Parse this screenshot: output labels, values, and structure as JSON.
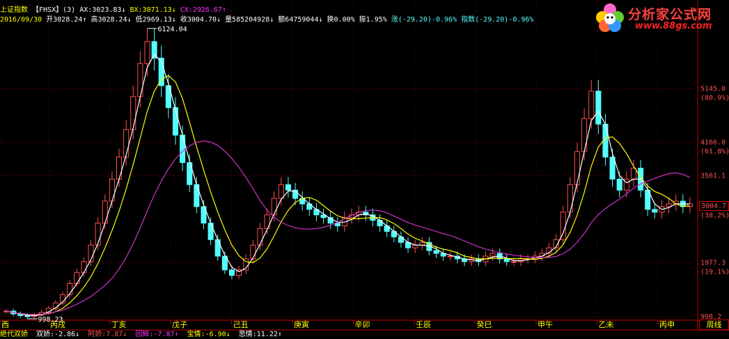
{
  "header": {
    "index_name": "上证指数",
    "indicator": "【FHSX】(3)",
    "ax": "AX:3023.83↓",
    "bx": "BX:3071.13↓",
    "cx": "CX:2926.67↑",
    "date": "2016/09/30",
    "open": "开3028.24↑",
    "high": "高3028.24↓",
    "low": "低2969.13↓",
    "close": "收3004.70↓",
    "volume": "量585204928↓",
    "amount": "额64759044↓",
    "turnover": "换0.00%",
    "amplitude": "振1.95%",
    "change": "涨(-29.20)-0.96%",
    "index_change": "指数(-29.20)-0.96%"
  },
  "logo": {
    "title": "分析家公式网",
    "url": "www.88gs.com"
  },
  "price_axis": {
    "labels": [
      {
        "price": 5145.0,
        "text": "5145.0",
        "pct": "(80.9%)"
      },
      {
        "price": 4166.0,
        "text": "4166.0",
        "pct": "(61.8%)"
      },
      {
        "price": 3561.1,
        "text": "3561.1",
        "pct": ""
      },
      {
        "price": 3004.7,
        "text": "3004.7",
        "pct": "(38.2%)"
      },
      {
        "price": 1977.3,
        "text": "1977.3",
        "pct": "(19.1%)"
      },
      {
        "price": 998.2,
        "text": "998.2",
        "pct": ""
      }
    ],
    "current": "3004.7",
    "high_marker": "6124.04",
    "low_marker": "998.23"
  },
  "time_axis": [
    "西",
    "丙戌",
    "丁亥",
    "戊子",
    "己丑",
    "庚寅",
    "辛卯",
    "壬辰",
    "癸巳",
    "甲午",
    "乙未",
    "丙申"
  ],
  "cycle_button": "周线",
  "bottom": {
    "name": "绝代双娇",
    "items": [
      {
        "text": "双娇:-2.86↓",
        "color": "#ffffff"
      },
      {
        "text": "阿娇:7.87↓",
        "color": "#ff5050"
      },
      {
        "text": "回辉:-7.87↑",
        "color": "#ff33ff"
      },
      {
        "text": "宝情:-6.90↓",
        "color": "#ffff00"
      },
      {
        "text": "悲情:11.22↑",
        "color": "#ffffff"
      }
    ]
  },
  "colors": {
    "ma_fast": "#ffffff",
    "ma_mid": "#ffff00",
    "ma_slow": "#cc33cc",
    "up": "#ff5050",
    "down": "#54ffff",
    "grid": "#8b0000"
  },
  "chart_data": {
    "type": "candlestick",
    "ylim": [
      998.2,
      6124.04
    ],
    "series": [
      {
        "name": "close",
        "values": [
          1100,
          1050,
          1020,
          1000,
          1030,
          1080,
          1150,
          1250,
          1400,
          1600,
          1800,
          2000,
          2300,
          2700,
          3100,
          3500,
          3900,
          4400,
          5000,
          5600,
          6000,
          5700,
          5200,
          4800,
          4300,
          3800,
          3400,
          3000,
          2700,
          2400,
          2100,
          1850,
          1750,
          1850,
          2050,
          2300,
          2600,
          2850,
          3150,
          3400,
          3300,
          3150,
          3050,
          2950,
          2850,
          2800,
          2700,
          2650,
          2800,
          2850,
          2900,
          2850,
          2750,
          2650,
          2550,
          2450,
          2350,
          2250,
          2300,
          2350,
          2200,
          2150,
          2100,
          2100,
          2050,
          2000,
          2050,
          2000,
          2100,
          2150,
          2050,
          2000,
          2000,
          2050,
          2050,
          2100,
          2150,
          2250,
          2400,
          2900,
          3400,
          4000,
          4600,
          5100,
          4500,
          3900,
          3500,
          3300,
          3500,
          3700,
          3300,
          2950,
          2900,
          3000,
          3050,
          3100,
          3000,
          3050
        ]
      }
    ]
  }
}
